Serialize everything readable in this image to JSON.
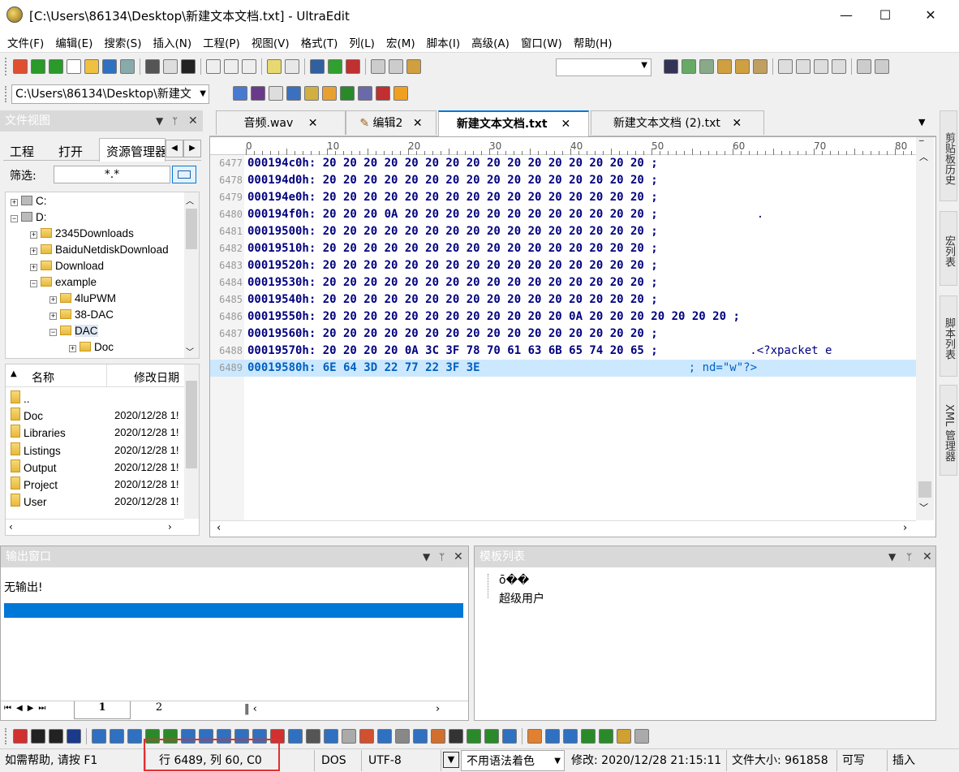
{
  "window": {
    "title": "[C:\\Users\\86134\\Desktop\\新建文本文档.txt] - UltraEdit",
    "minimize": "—",
    "maximize": "☐",
    "close": "✕"
  },
  "menu": [
    "文件(F)",
    "编辑(E)",
    "搜索(S)",
    "插入(N)",
    "工程(P)",
    "视图(V)",
    "格式(T)",
    "列(L)",
    "宏(M)",
    "脚本(I)",
    "高级(A)",
    "窗口(W)",
    "帮助(H)"
  ],
  "toolbar2": {
    "path": "C:\\Users\\86134\\Desktop\\新建文"
  },
  "filepane": {
    "title": "文件视图",
    "tabs": [
      "工程",
      "打开",
      "资源管理器"
    ],
    "filter_label": "筛选:",
    "filter_value": "*.*",
    "tree": [
      {
        "label": "C:",
        "level": 0,
        "exp": "+"
      },
      {
        "label": "D:",
        "level": 0,
        "exp": "−"
      },
      {
        "label": "2345Downloads",
        "level": 1,
        "exp": "+"
      },
      {
        "label": "BaiduNetdiskDownload",
        "level": 1,
        "exp": "+"
      },
      {
        "label": "Download",
        "level": 1,
        "exp": "+"
      },
      {
        "label": "example",
        "level": 1,
        "exp": "−"
      },
      {
        "label": "4luPWM",
        "level": 2,
        "exp": "+"
      },
      {
        "label": "38-DAC",
        "level": 2,
        "exp": "+"
      },
      {
        "label": "DAC",
        "level": 2,
        "exp": "−"
      },
      {
        "label": "Doc",
        "level": 3,
        "exp": "+"
      }
    ],
    "list_headers": [
      "名称",
      "修改日期"
    ],
    "list": [
      {
        "name": "..",
        "date": ""
      },
      {
        "name": "Doc",
        "date": "2020/12/28 1!"
      },
      {
        "name": "Libraries",
        "date": "2020/12/28 1!"
      },
      {
        "name": "Listings",
        "date": "2020/12/28 1!"
      },
      {
        "name": "Output",
        "date": "2020/12/28 1!"
      },
      {
        "name": "Project",
        "date": "2020/12/28 1!"
      },
      {
        "name": "User",
        "date": "2020/12/28 1!"
      }
    ]
  },
  "tabs": [
    "音频.wav",
    "编辑2",
    "新建文本文档.txt",
    "新建文本文档 (2).txt"
  ],
  "ruler": [
    "0",
    "10",
    "20",
    "30",
    "40",
    "50",
    "60",
    "70",
    "80"
  ],
  "hex": [
    {
      "n": "6477",
      "h": "000194c0h: 20 20 20 20 20 20 20 20 20 20 20 20 20 20 20 20 ;",
      "a": ""
    },
    {
      "n": "6478",
      "h": "000194d0h: 20 20 20 20 20 20 20 20 20 20 20 20 20 20 20 20 ;",
      "a": ""
    },
    {
      "n": "6479",
      "h": "000194e0h: 20 20 20 20 20 20 20 20 20 20 20 20 20 20 20 20 ;",
      "a": ""
    },
    {
      "n": "6480",
      "h": "000194f0h: 20 20 20 0A 20 20 20 20 20 20 20 20 20 20 20 20 ;",
      "a": "    ."
    },
    {
      "n": "6481",
      "h": "00019500h: 20 20 20 20 20 20 20 20 20 20 20 20 20 20 20 20 ;",
      "a": ""
    },
    {
      "n": "6482",
      "h": "00019510h: 20 20 20 20 20 20 20 20 20 20 20 20 20 20 20 20 ;",
      "a": ""
    },
    {
      "n": "6483",
      "h": "00019520h: 20 20 20 20 20 20 20 20 20 20 20 20 20 20 20 20 ;",
      "a": ""
    },
    {
      "n": "6484",
      "h": "00019530h: 20 20 20 20 20 20 20 20 20 20 20 20 20 20 20 20 ;",
      "a": ""
    },
    {
      "n": "6485",
      "h": "00019540h: 20 20 20 20 20 20 20 20 20 20 20 20 20 20 20 20 ;",
      "a": ""
    },
    {
      "n": "6486",
      "h": "00019550h: 20 20 20 20 20 20 20 20 20 20 20 20 0A 20 20 20 20 20 20 20 ;",
      "a": ""
    },
    {
      "n": "6487",
      "h": "00019560h: 20 20 20 20 20 20 20 20 20 20 20 20 20 20 20 20 ;",
      "a": ""
    },
    {
      "n": "6488",
      "h": "00019570h: 20 20 20 20 0A 3C 3F 78 70 61 63 6B 65 74 20 65 ;",
      "a": "   .<?xpacket e"
    },
    {
      "n": "6489",
      "h": "00019580h: 6E 64 3D 22 77 22 3F 3E",
      "a": "                                ; nd=\"w\"?>"
    }
  ],
  "side_tabs": [
    "剪贴板历史",
    "宏列表",
    "脚本列表",
    "XML 管理器"
  ],
  "output": {
    "title": "输出窗口",
    "text": "无输出!",
    "tabs": [
      "1",
      "2"
    ]
  },
  "template": {
    "title": "模板列表",
    "items": [
      "ō��",
      "超级用户"
    ]
  },
  "status": {
    "help": "如需帮助, 请按 F1",
    "pos": "行 6489, 列 60, C0",
    "eol": "DOS",
    "enc": "UTF-8",
    "syntax": "不用语法着色",
    "modified": "修改: 2020/12/28 21:15:11",
    "size": "文件大小: 961858",
    "rw": "可写",
    "ins": "插入"
  },
  "colors": {
    "accent_blue": "#0078d7",
    "selected_line": "#cce8ff",
    "highlight_box": "#e03030"
  }
}
